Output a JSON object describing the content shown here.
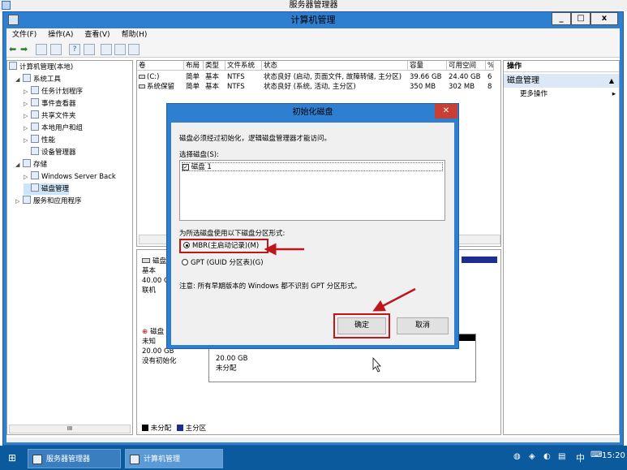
{
  "outer_window": {
    "title": "服务器管理器",
    "minimize": "_",
    "restore": "❐",
    "close": "x"
  },
  "window": {
    "title": "计算机管理",
    "minimize": "_",
    "maximize": "□",
    "close": "x"
  },
  "menubar": [
    "文件(F)",
    "操作(A)",
    "查看(V)",
    "帮助(H)"
  ],
  "tree": {
    "root": "计算机管理(本地)",
    "items": [
      {
        "label": "系统工具",
        "icon": "tools-icon",
        "expander": "◢"
      },
      {
        "label": "任务计划程序",
        "icon": "clock-icon",
        "expander": "▷"
      },
      {
        "label": "事件查看器",
        "icon": "event-viewer-icon",
        "expander": "▷"
      },
      {
        "label": "共享文件夹",
        "icon": "shared-folder-icon",
        "expander": "▷"
      },
      {
        "label": "本地用户和组",
        "icon": "users-icon",
        "expander": "▷"
      },
      {
        "label": "性能",
        "icon": "performance-icon",
        "expander": "▷"
      },
      {
        "label": "设备管理器",
        "icon": "device-manager-icon",
        "expander": ""
      },
      {
        "label": "存储",
        "icon": "storage-icon",
        "expander": "◢"
      },
      {
        "label": "Windows Server Back",
        "icon": "backup-icon",
        "expander": "▷"
      },
      {
        "label": "磁盘管理",
        "icon": "disk-icon",
        "expander": ""
      },
      {
        "label": "服务和应用程序",
        "icon": "services-icon",
        "expander": "▷"
      }
    ],
    "scroll_mark": "III"
  },
  "volume_table": {
    "headers": [
      "卷",
      "布局",
      "类型",
      "文件系统",
      "状态",
      "容量",
      "可用空间",
      "%"
    ],
    "rows": [
      [
        "(C:)",
        "简单",
        "基本",
        "NTFS",
        "状态良好 (启动, 页面文件, 故障转储, 主分区)",
        "39.66 GB",
        "24.40 GB",
        "6"
      ],
      [
        "系统保留",
        "简单",
        "基本",
        "NTFS",
        "状态良好 (系统, 活动, 主分区)",
        "350 MB",
        "302 MB",
        "8"
      ]
    ]
  },
  "disk_graph": {
    "disk0": {
      "name": "磁盘",
      "type": "基本",
      "size": "40.00 GB",
      "status": "联机"
    },
    "disk1": {
      "name": "磁盘",
      "type": "未知",
      "size": "20.00 GB",
      "status": "没有初始化",
      "part_size": "20.00 GB",
      "part_status": "未分配"
    },
    "legend": [
      "未分配",
      "主分区"
    ]
  },
  "actions": {
    "header": "操作",
    "section": "磁盘管理",
    "item": "更多操作"
  },
  "dialog": {
    "title": "初始化磁盘",
    "close": "✕",
    "intro": "磁盘必须经过初始化，逻辑磁盘管理器才能访问。",
    "select_label": "选择磁盘(S):",
    "disks": [
      "磁盘 1"
    ],
    "style_label": "为所选磁盘使用以下磁盘分区形式:",
    "mbr": "MBR(主启动记录)(M)",
    "gpt": "GPT (GUID 分区表)(G)",
    "note": "注意: 所有早期版本的 Windows 都不识别 GPT 分区形式。",
    "ok": "确定",
    "cancel": "取消"
  },
  "taskbar": {
    "items": [
      "服务器管理器",
      "计算机管理"
    ],
    "time": "15:20",
    "tray": "中"
  }
}
